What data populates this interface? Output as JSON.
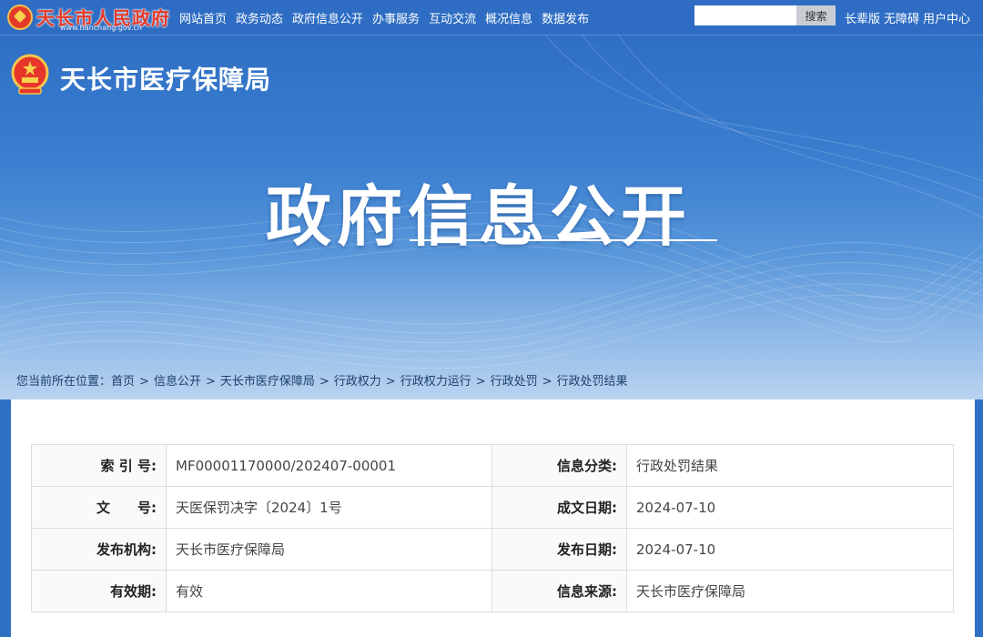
{
  "topbar": {
    "site_name": "天长市人民政府",
    "site_domain": "www.tianchang.gov.cn",
    "nav": [
      "网站首页",
      "政务动态",
      "政府信息公开",
      "办事服务",
      "互动交流",
      "概况信息",
      "数据发布"
    ],
    "search_placeholder": "",
    "search_button": "搜索",
    "links": [
      "长辈版",
      "无障碍",
      "用户中心"
    ]
  },
  "banner": {
    "bureau_name": "天长市医疗保障局",
    "title": "政府信息公开"
  },
  "breadcrumb": {
    "prefix": "您当前所在位置：",
    "items": [
      "首页",
      "信息公开",
      "天长市医疗保障局",
      "行政权力",
      "行政权力运行",
      "行政处罚",
      "行政处罚结果"
    ],
    "separator": ">"
  },
  "meta": {
    "rows": [
      {
        "l1": "索 引 号:",
        "v1": "MF00001170000/202407-00001",
        "l2": "信息分类:",
        "v2": "行政处罚结果"
      },
      {
        "l1": "文　　号:",
        "v1": "天医保罚决字〔2024〕1号",
        "l2": "成文日期:",
        "v2": "2024-07-10"
      },
      {
        "l1": "发布机构:",
        "v1": "天长市医疗保障局",
        "l2": "发布日期:",
        "v2": "2024-07-10"
      },
      {
        "l1": "有效期:",
        "v1": "有效",
        "l2": "信息来源:",
        "v2": "天长市医疗保障局"
      }
    ]
  },
  "colors": {
    "topbar": "#2e6dc3",
    "site_name": "#e33a2a",
    "banner_top": "#2f6fc4",
    "banner_bottom": "#b9d3f0"
  }
}
